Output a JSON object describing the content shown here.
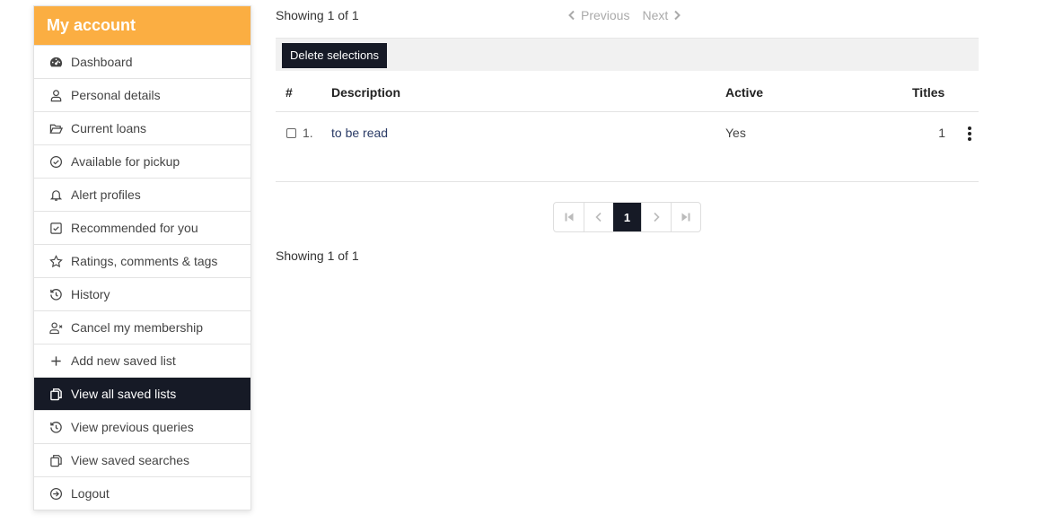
{
  "sidebar": {
    "title": "My account",
    "accent_color": "#fbae42",
    "active_color": "#161a26",
    "items": [
      {
        "label": "Dashboard",
        "icon": "dashboard-icon"
      },
      {
        "label": "Personal details",
        "icon": "user-icon"
      },
      {
        "label": "Current loans",
        "icon": "folder-open-icon"
      },
      {
        "label": "Available for pickup",
        "icon": "check-circle-icon"
      },
      {
        "label": "Alert profiles",
        "icon": "bell-icon"
      },
      {
        "label": "Recommended for you",
        "icon": "check-square-icon"
      },
      {
        "label": "Ratings, comments & tags",
        "icon": "star-icon"
      },
      {
        "label": "History",
        "icon": "history-icon"
      },
      {
        "label": "Cancel my membership",
        "icon": "user-x-icon"
      },
      {
        "label": "Add new saved list",
        "icon": "plus-icon"
      },
      {
        "label": "View all saved lists",
        "icon": "copy-icon",
        "active": true
      },
      {
        "label": "View previous queries",
        "icon": "history-icon"
      },
      {
        "label": "View saved searches",
        "icon": "copy-icon"
      },
      {
        "label": "Logout",
        "icon": "arrow-right-circle-icon"
      }
    ]
  },
  "main": {
    "showing_top": "Showing 1 of 1",
    "previous_label": "Previous",
    "next_label": "Next",
    "delete_button": "Delete selections",
    "table": {
      "headers": {
        "num": "#",
        "description": "Description",
        "active": "Active",
        "titles": "Titles"
      },
      "rows": [
        {
          "num": "1.",
          "description": "to be read",
          "active": "Yes",
          "titles": "1",
          "checked": false
        }
      ]
    },
    "pagination": {
      "current_page": "1"
    },
    "showing_bottom": "Showing 1 of 1"
  }
}
